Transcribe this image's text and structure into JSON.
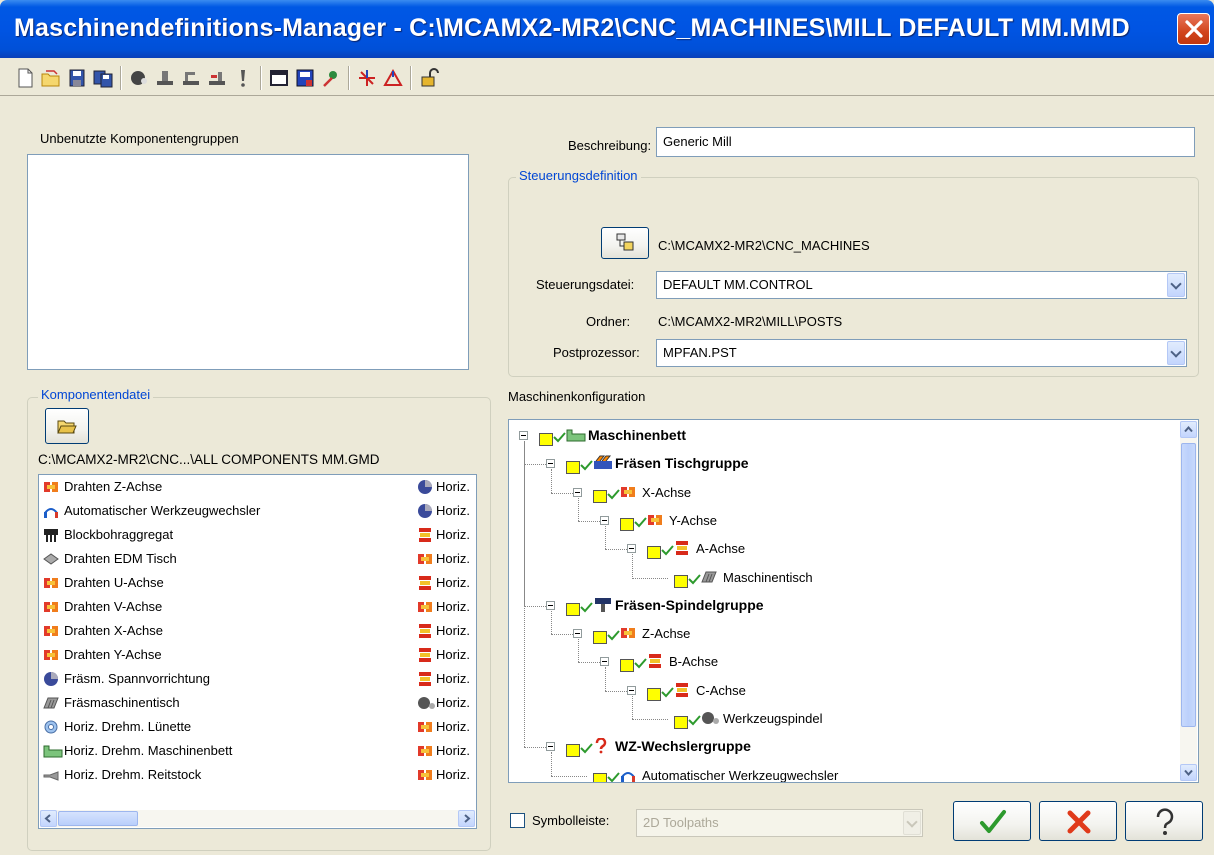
{
  "window": {
    "title": "Maschinendefinitions-Manager - C:\\MCAMX2-MR2\\CNC_MACHINES\\MILL DEFAULT MM.MMD"
  },
  "toolbar": {
    "icons": [
      "new-file-icon",
      "open-file-icon",
      "save-icon",
      "save-as-icon",
      "component-icon",
      "machine-icon-1",
      "machine-icon-2",
      "machine-icon-3",
      "exclamation-icon",
      "window-icon",
      "save-blue-icon",
      "pointer-icon",
      "axis-icon",
      "axis-triangle-icon",
      "lock-icon"
    ]
  },
  "left": {
    "unused_label": "Unbenutzte Komponentengruppen",
    "component_group_title": "Komponentendatei",
    "component_path": "C:\\MCAMX2-MR2\\CNC...\\ALL COMPONENTS MM.GMD",
    "components": [
      {
        "name": "Drahten Z-Achse",
        "icon": "axis-block-icon",
        "type": "Horiz.",
        "type_icon": "disc-icon"
      },
      {
        "name": "Automatischer Werkzeugwechsler",
        "icon": "tool-changer-icon",
        "type": "Horiz.",
        "type_icon": "disc-icon"
      },
      {
        "name": "Blockbohraggregat",
        "icon": "block-drill-icon",
        "type": "Horiz.",
        "type_icon": "rotary-icon"
      },
      {
        "name": "Drahten EDM Tisch",
        "icon": "edm-table-icon",
        "type": "Horiz.",
        "type_icon": "axis-block-icon"
      },
      {
        "name": "Drahten U-Achse",
        "icon": "axis-block-icon",
        "type": "Horiz.",
        "type_icon": "rotary-icon"
      },
      {
        "name": "Drahten V-Achse",
        "icon": "axis-block-icon",
        "type": "Horiz.",
        "type_icon": "axis-block-icon"
      },
      {
        "name": "Drahten X-Achse",
        "icon": "axis-block-icon",
        "type": "Horiz.",
        "type_icon": "rotary-icon"
      },
      {
        "name": "Drahten Y-Achse",
        "icon": "axis-block-icon",
        "type": "Horiz.",
        "type_icon": "rotary-icon"
      },
      {
        "name": "Fräsm. Spannvorrichtung",
        "icon": "disc-icon",
        "type": "Horiz.",
        "type_icon": "rotary-icon"
      },
      {
        "name": "Fräsmaschinentisch",
        "icon": "table-icon",
        "type": "Horiz.",
        "type_icon": "spindle-icon"
      },
      {
        "name": "Horiz. Drehm. Lünette",
        "icon": "steady-rest-icon",
        "type": "Horiz.",
        "type_icon": "axis-block-icon"
      },
      {
        "name": "Horiz. Drehm. Maschinenbett",
        "icon": "bed-icon",
        "type": "Horiz.",
        "type_icon": "axis-block-icon"
      },
      {
        "name": "Horiz. Drehm. Reitstock",
        "icon": "tailstock-icon",
        "type": "Horiz.",
        "type_icon": "axis-block-icon"
      }
    ]
  },
  "right": {
    "description_label": "Beschreibung:",
    "description_value": "Generic Mill",
    "control_group_title": "Steuerungsdefinition",
    "control_path": "C:\\MCAMX2-MR2\\CNC_MACHINES",
    "control_file_label": "Steuerungsdatei:",
    "control_file_value": "DEFAULT MM.CONTROL",
    "folder_label": "Ordner:",
    "folder_value": "C:\\MCAMX2-MR2\\MILL\\POSTS",
    "post_label": "Postprozessor:",
    "post_value": "MPFAN.PST",
    "config_label": "Maschinenkonfiguration"
  },
  "tree": [
    {
      "label": "Maschinenbett",
      "bold": true,
      "icon": "bed-icon"
    },
    {
      "label": "Fräsen Tischgruppe",
      "bold": true,
      "icon": "table-group-icon"
    },
    {
      "label": "X-Achse",
      "bold": false,
      "icon": "axis-block-icon"
    },
    {
      "label": "Y-Achse",
      "bold": false,
      "icon": "axis-block-icon"
    },
    {
      "label": "A-Achse",
      "bold": false,
      "icon": "rotary-icon"
    },
    {
      "label": "Maschinentisch",
      "bold": false,
      "icon": "table-icon"
    },
    {
      "label": "Fräsen-Spindelgruppe",
      "bold": true,
      "icon": "spindle-group-icon"
    },
    {
      "label": "Z-Achse",
      "bold": false,
      "icon": "axis-block-icon"
    },
    {
      "label": "B-Achse",
      "bold": false,
      "icon": "rotary-icon"
    },
    {
      "label": "C-Achse",
      "bold": false,
      "icon": "rotary-icon"
    },
    {
      "label": "Werkzeugspindel",
      "bold": false,
      "icon": "spindle-icon"
    },
    {
      "label": "WZ-Wechslergruppe",
      "bold": true,
      "icon": "question-icon"
    },
    {
      "label": "Automatischer Werkzeugwechsler",
      "bold": false,
      "icon": "tool-changer-icon"
    }
  ],
  "bottom": {
    "toolbar_label": "Symbolleiste:",
    "toolbar_value": "2D Toolpaths",
    "ok_icon": "checkmark-icon",
    "cancel_icon": "x-icon",
    "help_icon": "question-mark-icon"
  },
  "colors": {
    "titlebar": "#0054e3",
    "group_title": "#0046d5",
    "window_bg": "#ece9d8"
  }
}
